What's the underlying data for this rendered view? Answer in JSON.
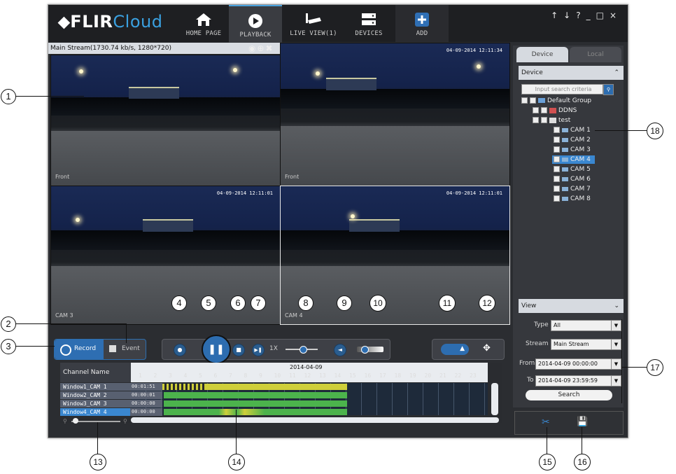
{
  "app": {
    "logo_main": "⬥FLIR",
    "logo_cloud": "Cloud"
  },
  "nav": {
    "tabs": [
      {
        "label": "HOME PAGE",
        "icon": "home-icon"
      },
      {
        "label": "PLAYBACK",
        "icon": "play-icon"
      },
      {
        "label": "LIVE VIEW(1)",
        "icon": "camera-icon"
      },
      {
        "label": "DEVICES",
        "icon": "devices-icon"
      },
      {
        "label": "ADD",
        "icon": "plus-icon"
      }
    ],
    "active": "PLAYBACK"
  },
  "window_controls": [
    "↑",
    "↓",
    "?",
    "_",
    "□",
    "×"
  ],
  "stream_info": "Main Stream(1730.74 kb/s, 1280*720)",
  "cameras": [
    {
      "timestamp": "",
      "caption": "Front"
    },
    {
      "timestamp": "04-09-2014 12:11:34",
      "caption": "Front"
    },
    {
      "timestamp": "04-09-2014 12:11:01",
      "caption": "CAM 3"
    },
    {
      "timestamp": "04-09-2014 12:11:01",
      "caption": "CAM 4"
    }
  ],
  "controls": {
    "record_label": "Record",
    "event_label": "Event",
    "speed_label": "1X"
  },
  "right_panel": {
    "tab_device": "Device",
    "tab_local": "Local",
    "device_section": "Device",
    "search_placeholder": "Input search criteria",
    "tree": {
      "group": "Default Group",
      "ddns": "DDNS",
      "test": "test",
      "cams": [
        "CAM 1",
        "CAM 2",
        "CAM 3",
        "CAM 4",
        "CAM 5",
        "CAM 6",
        "CAM 7",
        "CAM 8"
      ],
      "selected": "CAM 4"
    },
    "view_section": "View",
    "form": {
      "type_label": "Type",
      "type_value": "All",
      "stream_label": "Stream",
      "stream_value": "Main Stream",
      "from_label": "From",
      "from_value": "2014-04-09 00:00:00",
      "to_label": "To",
      "to_value": "2014-04-09 23:59:59",
      "search_button": "Search"
    }
  },
  "timeline": {
    "channel_header": "Channel Name",
    "date": "2014-04-09",
    "hours": [
      "1",
      "2",
      "3",
      "4",
      "5",
      "6",
      "7",
      "8",
      "9",
      "10",
      "11",
      "12",
      "13",
      "14",
      "15",
      "16",
      "17",
      "18",
      "19",
      "20",
      "21",
      "22",
      "23"
    ],
    "channels": [
      {
        "name": "Window1_CAM 1",
        "time": "00:01:51"
      },
      {
        "name": "Window2_CAM 2",
        "time": "00:00:01"
      },
      {
        "name": "Window3_CAM 3",
        "time": "00:00:00"
      },
      {
        "name": "Window4_CAM 4",
        "time": "00:00:00"
      }
    ]
  },
  "callouts": [
    "1",
    "2",
    "3",
    "4",
    "5",
    "6",
    "7",
    "8",
    "9",
    "10",
    "11",
    "12",
    "13",
    "14",
    "15",
    "16",
    "17",
    "18"
  ]
}
